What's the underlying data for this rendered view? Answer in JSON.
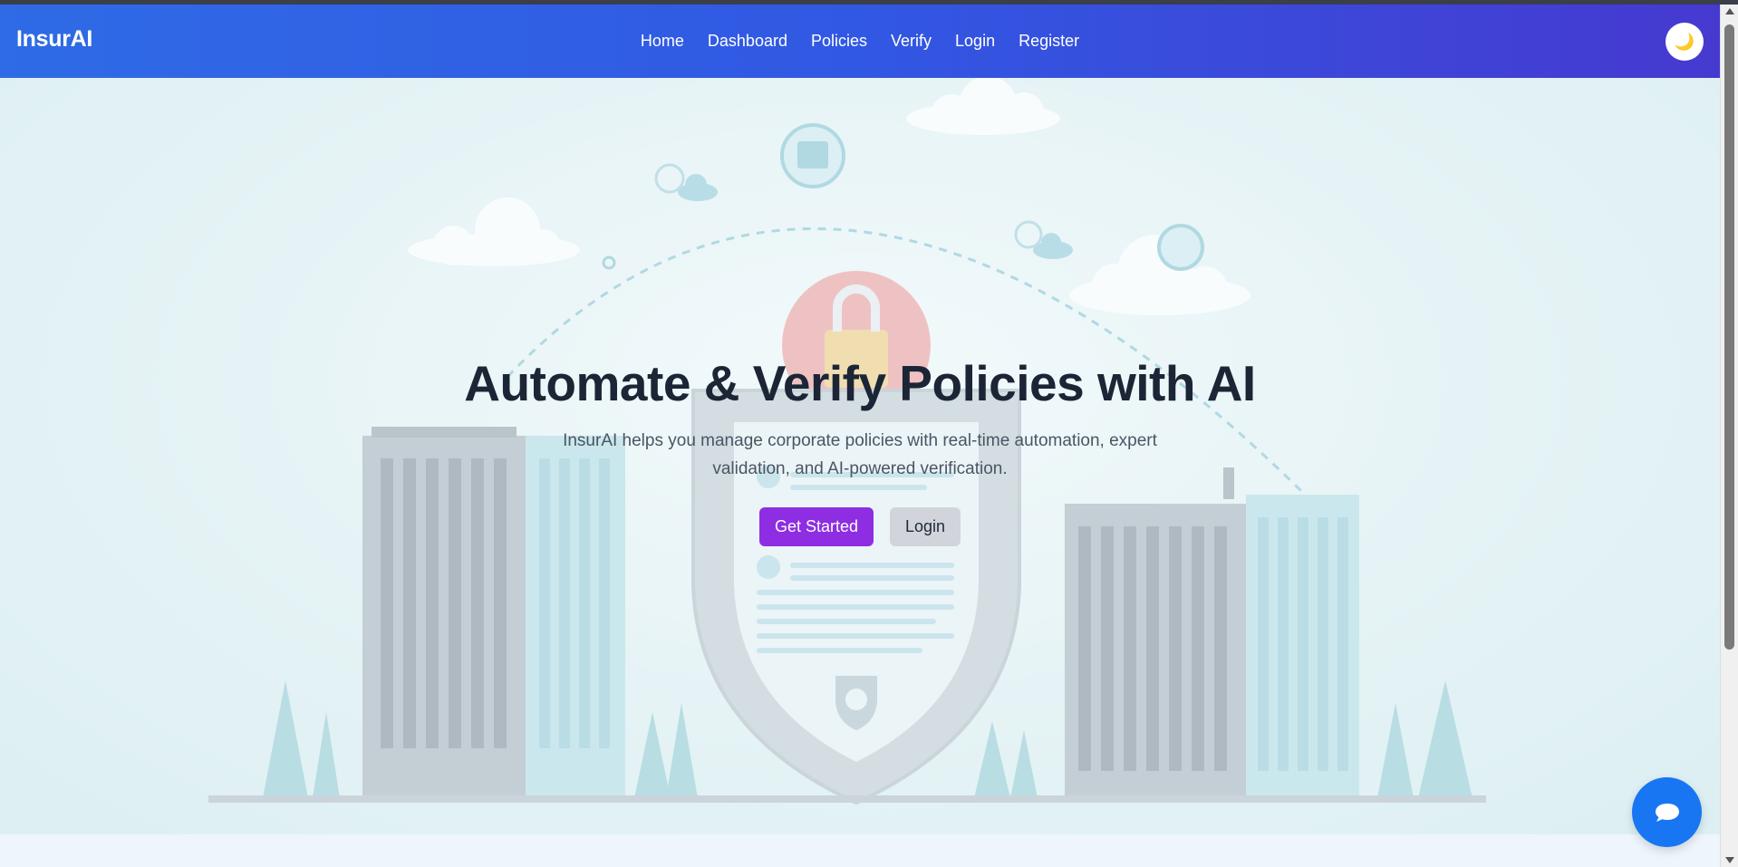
{
  "nav": {
    "brand": "InsurAI",
    "links": [
      {
        "label": "Home"
      },
      {
        "label": "Dashboard"
      },
      {
        "label": "Policies"
      },
      {
        "label": "Verify"
      },
      {
        "label": "Login"
      },
      {
        "label": "Register"
      }
    ],
    "theme_toggle_icon": "moon-icon",
    "theme_toggle_glyph": "🌙"
  },
  "hero": {
    "title": "Automate & Verify Policies with AI",
    "subtitle": "InsurAI helps you manage corporate policies with real-time automation, expert validation, and AI-powered verification.",
    "primary_button": "Get Started",
    "secondary_button": "Login"
  },
  "chat": {
    "icon": "chat-bubble-icon"
  },
  "colors": {
    "nav_gradient_start": "#2f6be6",
    "nav_gradient_end": "#4639d0",
    "primary_button": "#8e2de2",
    "secondary_button": "#d1d5db",
    "chat_button": "#1976f2",
    "title_text": "#1b2535"
  }
}
